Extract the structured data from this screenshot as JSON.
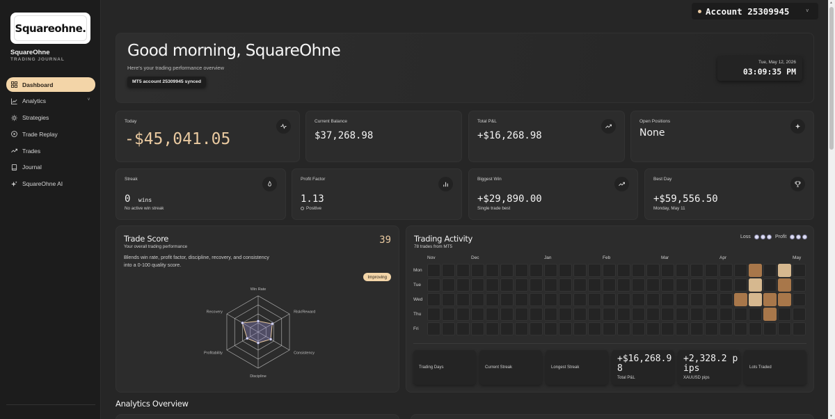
{
  "brand": {
    "logo_text": "Squareohne.",
    "name": "SquareOhne",
    "subtitle": "TRADING JOURNAL"
  },
  "sidebar": {
    "items": [
      {
        "label": "Dashboard",
        "icon": "dashboard-icon",
        "active": true
      },
      {
        "label": "Analytics",
        "icon": "chart-line-icon",
        "has_chevron": true
      },
      {
        "label": "Strategies",
        "icon": "sun-gear-icon"
      },
      {
        "label": "Trade Replay",
        "icon": "play-icon"
      },
      {
        "label": "Trades",
        "icon": "trend-icon"
      },
      {
        "label": "Journal",
        "icon": "book-icon"
      },
      {
        "label": "SquareOhne AI",
        "icon": "sparkle-icon"
      }
    ],
    "chevron": "v"
  },
  "account": {
    "label": "Account 25309945",
    "chevron": "v"
  },
  "hero": {
    "greeting": "Good morning, SquareOhne",
    "subtitle": "Here's your trading performance overview",
    "sync_status": "MT5 account 25309945 synced",
    "date": "Tue, May 12, 2026",
    "time": "03:09:35 PM"
  },
  "stats": {
    "today": {
      "label": "Today",
      "value": "-$45,041.05"
    },
    "current_balance": {
      "label": "Current Balance",
      "value": "$37,268.98"
    },
    "total_pnl": {
      "label": "Total P&L",
      "value": "+$16,268.98"
    },
    "open_positions": {
      "label": "Open Positions",
      "value": "None"
    },
    "streak": {
      "label": "Streak",
      "value": "0",
      "unit": "wins",
      "sub": "No active win streak"
    },
    "profit_factor": {
      "label": "Profit Factor",
      "value": "1.13",
      "sub": "Positive"
    },
    "biggest_win": {
      "label": "Biggest Win",
      "value": "+$29,890.00",
      "sub": "Single trade best"
    },
    "best_day": {
      "label": "Best Day",
      "value": "+$59,556.50",
      "sub": "Monday, May 11"
    }
  },
  "trade_score": {
    "title": "Trade Score",
    "subtitle": "Your overall trading performance",
    "score": "39",
    "description": "Blends win rate, profit factor, discipline, recovery, and consistency into a 0-100 quality score.",
    "badge": "Improving",
    "radar_axes": [
      "Win Rate",
      "Risk/Reward",
      "Consistency",
      "Discipline",
      "Profitability",
      "Recovery"
    ],
    "radar_values": [
      0.3,
      0.45,
      0.4,
      0.3,
      0.35,
      0.5
    ]
  },
  "trading_activity": {
    "title": "Trading Activity",
    "subtitle": "78 trades from MT5",
    "legend_loss": "Loss",
    "legend_profit": "Profit",
    "months": [
      "Nov",
      "Dec",
      "Jan",
      "Feb",
      "Mar",
      "Apr",
      "May"
    ],
    "days": [
      "Mon",
      "Tue",
      "Wed",
      "Thu",
      "Fri"
    ],
    "highlighted_cells": [
      {
        "week": 22,
        "day": 0,
        "color": "#a8774a"
      },
      {
        "week": 24,
        "day": 0,
        "color": "#d6b88f"
      },
      {
        "week": 22,
        "day": 1,
        "color": "#d6b88f"
      },
      {
        "week": 24,
        "day": 1,
        "color": "#a8774a"
      },
      {
        "week": 21,
        "day": 2,
        "color": "#a8774a"
      },
      {
        "week": 22,
        "day": 2,
        "color": "#d6b88f"
      },
      {
        "week": 23,
        "day": 2,
        "color": "#a8774a"
      },
      {
        "week": 24,
        "day": 2,
        "color": "#a8774a"
      },
      {
        "week": 23,
        "day": 3,
        "color": "#a8774a"
      }
    ],
    "summary": [
      {
        "label": "Trading Days",
        "value": ""
      },
      {
        "label": "Current Streak",
        "value": ""
      },
      {
        "label": "Longest Streak",
        "value": ""
      },
      {
        "label": "Total P&L",
        "value": "+$16,268.98"
      },
      {
        "label": "XAUUSD pips",
        "value": "+2,328.2 pips"
      },
      {
        "label": "Lots Traded",
        "value": ""
      }
    ]
  },
  "analytics_overview": {
    "title": "Analytics Overview"
  },
  "colors": {
    "accent": "#f3d5a8",
    "score": "#e9c9a0",
    "background": "#262626",
    "card": "#2c2c2c"
  }
}
